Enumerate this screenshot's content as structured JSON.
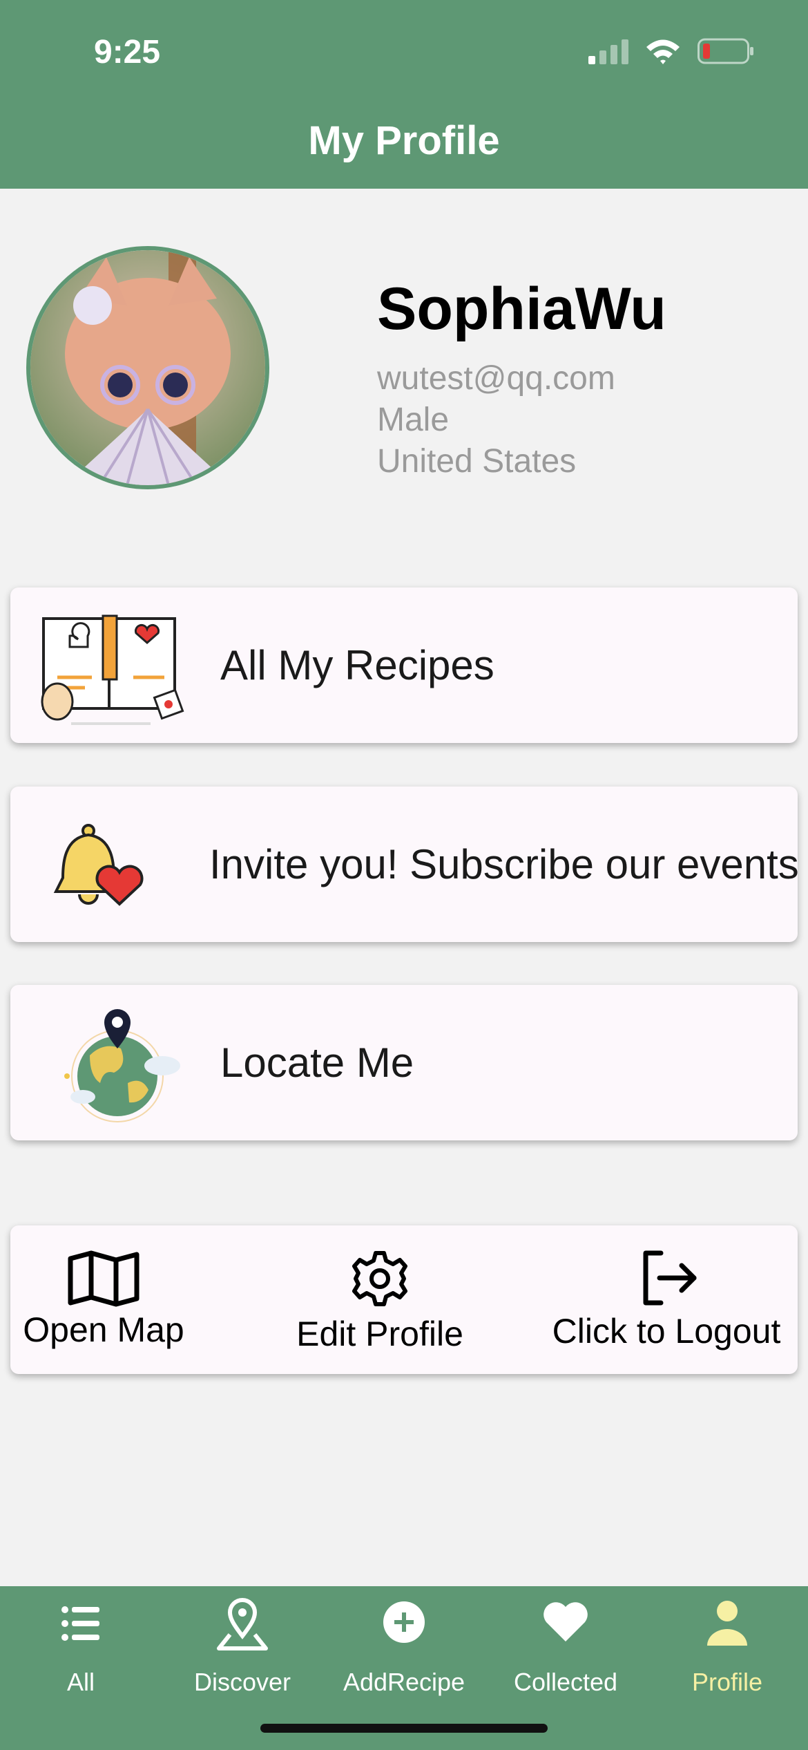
{
  "status_bar": {
    "time": "9:25"
  },
  "header": {
    "title": "My Profile"
  },
  "profile": {
    "name": "SophiaWu",
    "email": "wutest@qq.com",
    "gender": "Male",
    "country": "United States"
  },
  "menu": [
    {
      "label": "All My Recipes",
      "icon": "recipe-book-icon"
    },
    {
      "label": "Invite you! Subscribe our events",
      "icon": "bell-heart-icon"
    },
    {
      "label": "Locate Me",
      "icon": "globe-pin-icon"
    }
  ],
  "actions": {
    "open_map": "Open Map",
    "edit_profile": "Edit Profile",
    "logout": "Click to Logout"
  },
  "tabs": [
    {
      "label": "All",
      "icon": "list-icon"
    },
    {
      "label": "Discover",
      "icon": "map-pin-icon"
    },
    {
      "label": "AddRecipe",
      "icon": "plus-circle-icon"
    },
    {
      "label": "Collected",
      "icon": "heart-icon"
    },
    {
      "label": "Profile",
      "icon": "person-icon",
      "active": true
    }
  ],
  "colors": {
    "brand": "#5e9874",
    "active_tab": "#f6f0a4",
    "card_bg": "#fdf8fc"
  }
}
